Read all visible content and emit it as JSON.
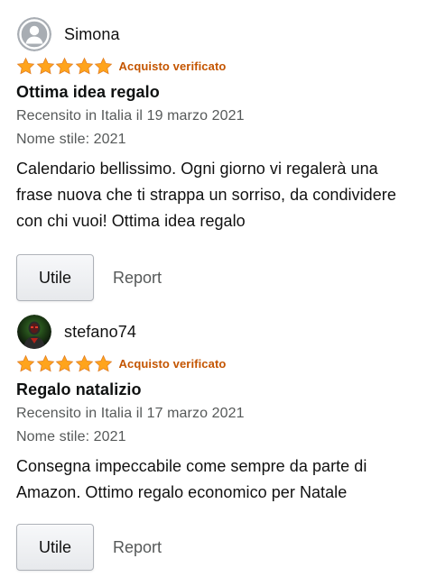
{
  "colors": {
    "star": "#ffa41c",
    "verified": "#c45500",
    "meta": "#565959"
  },
  "reviews": [
    {
      "author": "Simona",
      "avatar_icon": "default-user-avatar-icon",
      "rating": 5,
      "rating_max": 5,
      "verified_label": "Acquisto verificato",
      "title": "Ottima idea regalo",
      "reviewed_line": "Recensito in Italia il 19 marzo 2021",
      "style_line": "Nome stile: 2021",
      "body": "Calendario bellissimo. Ogni giorno vi regalerà una frase nuova che ti strappa un sorriso, da condividere con chi vuoi! Ottima idea regalo",
      "helpful_label": "Utile",
      "report_label": "Report"
    },
    {
      "author": "stefano74",
      "avatar_icon": "profile-photo-avatar",
      "rating": 5,
      "rating_max": 5,
      "verified_label": "Acquisto verificato",
      "title": "Regalo natalizio",
      "reviewed_line": "Recensito in Italia il 17 marzo 2021",
      "style_line": "Nome stile: 2021",
      "body": "Consegna impeccabile come sempre da parte di Amazon. Ottimo regalo economico per Natale",
      "helpful_label": "Utile",
      "report_label": "Report"
    }
  ]
}
